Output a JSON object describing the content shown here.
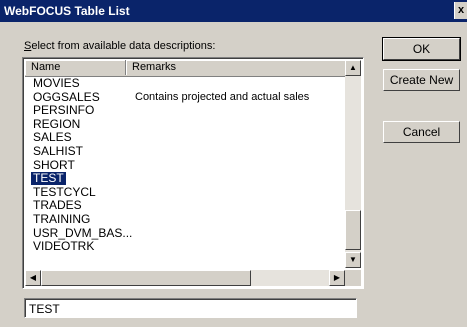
{
  "window": {
    "title": "WebFOCUS Table List",
    "close_glyph": "x"
  },
  "prompt": {
    "accel": "S",
    "rest": "elect from available data descriptions:"
  },
  "list": {
    "columns": {
      "name": "Name",
      "remarks": "Remarks"
    },
    "rows": [
      {
        "name": "MOVIES",
        "remarks": ""
      },
      {
        "name": "OGGSALES",
        "remarks": "Contains projected and actual sales"
      },
      {
        "name": "PERSINFO",
        "remarks": ""
      },
      {
        "name": "REGION",
        "remarks": ""
      },
      {
        "name": "SALES",
        "remarks": ""
      },
      {
        "name": "SALHIST",
        "remarks": ""
      },
      {
        "name": "SHORT",
        "remarks": ""
      },
      {
        "name": "TEST",
        "remarks": ""
      },
      {
        "name": "TESTCYCL",
        "remarks": ""
      },
      {
        "name": "TRADES",
        "remarks": ""
      },
      {
        "name": "TRAINING",
        "remarks": ""
      },
      {
        "name": "USR_DVM_BAS...",
        "remarks": ""
      },
      {
        "name": "VIDEOTRK",
        "remarks": ""
      }
    ],
    "selected_index": 7
  },
  "selection_field": {
    "value": "TEST"
  },
  "buttons": {
    "ok": "OK",
    "create_new": "Create New",
    "cancel": "Cancel"
  }
}
